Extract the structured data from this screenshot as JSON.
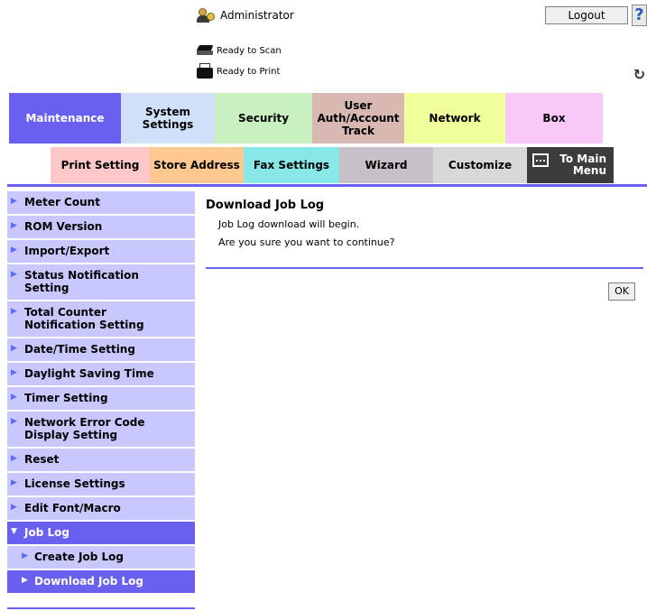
{
  "header": {
    "user_name": "Administrator",
    "logout_label": "Logout",
    "help_label": "?",
    "status_scan": "Ready to Scan",
    "status_print": "Ready to Print",
    "refresh_label": "↻"
  },
  "main_tabs": [
    {
      "label": "Maintenance",
      "color": "#6a60f0"
    },
    {
      "label": "System\nSettings",
      "color": "#cfe0f8"
    },
    {
      "label": "Security",
      "color": "#c8f0c0"
    },
    {
      "label": "User\nAuth/Account\nTrack",
      "color": "#d8b8b0"
    },
    {
      "label": "Network",
      "color": "#f0ff9c"
    },
    {
      "label": "Box",
      "color": "#f8c8f8"
    }
  ],
  "sub_tabs": [
    {
      "label": "Print Setting",
      "color": "#ffc8c8"
    },
    {
      "label": "Store Address",
      "color": "#ffc890"
    },
    {
      "label": "Fax Settings",
      "color": "#88e8e8"
    },
    {
      "label": "Wizard",
      "color": "#c8c0c8"
    },
    {
      "label": "Customize",
      "color": "#d8d8d8"
    },
    {
      "label": "To Main\nMenu",
      "color": "#3c3c3c"
    }
  ],
  "sidebar": {
    "items": [
      {
        "label": "Meter Count"
      },
      {
        "label": "ROM Version"
      },
      {
        "label": "Import/Export"
      },
      {
        "label": "Status Notification\nSetting"
      },
      {
        "label": "Total Counter\nNotification Setting"
      },
      {
        "label": "Date/Time Setting"
      },
      {
        "label": "Daylight Saving Time"
      },
      {
        "label": "Timer Setting"
      },
      {
        "label": "Network Error Code\nDisplay Setting"
      },
      {
        "label": "Reset"
      },
      {
        "label": "License Settings"
      },
      {
        "label": "Edit Font/Macro"
      },
      {
        "label": "Job Log"
      }
    ],
    "sub_items": [
      {
        "label": "Create Job Log"
      },
      {
        "label": "Download Job Log"
      }
    ],
    "collapsed_marker": "▶",
    "expanded_marker": "▼"
  },
  "content": {
    "title": "Download Job Log",
    "line1": "Job Log download will begin.",
    "line2": "Are you sure you want to continue?",
    "ok_label": "OK"
  },
  "colors": {
    "accent": "#6a60f0",
    "sidebar_bg": "#c8c8ff"
  }
}
